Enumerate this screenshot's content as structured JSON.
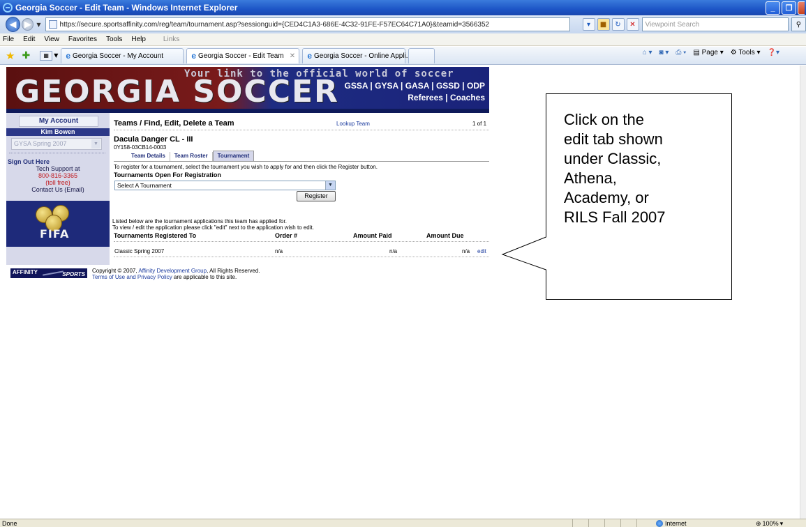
{
  "window": {
    "title": "Georgia Soccer - Edit Team - Windows Internet Explorer",
    "minimize_glyph": "_",
    "maximize_glyph": "❐",
    "close_glyph": "X"
  },
  "address_bar": {
    "url": "https://secure.sportsaffinity.com/reg/team/tournament.asp?sessionguid={CED4C1A3-686E-4C32-91FE-F57EC64C71A0}&teamid=3566352",
    "search_placeholder": "Viewpoint Search"
  },
  "menu": {
    "items": [
      "File",
      "Edit",
      "View",
      "Favorites",
      "Tools",
      "Help"
    ],
    "links_label": "Links"
  },
  "browser_tabs": [
    {
      "label": "Georgia Soccer - My Account",
      "active": false
    },
    {
      "label": "Georgia Soccer - Edit Team",
      "active": true
    },
    {
      "label": "Georgia Soccer - Online Appli...",
      "active": false
    }
  ],
  "command_bar": {
    "page_label": "Page",
    "tools_label": "Tools"
  },
  "banner": {
    "logo": "GEORGIA SOCCER",
    "tagline": "Your link to the official world of soccer",
    "orgs": "GSSA | GYSA | GASA | GSSD | ODP",
    "refs": "Referees | Coaches"
  },
  "sidebar": {
    "my_account": "My Account",
    "user_name": "Kim Bowen",
    "season_select": "GYSA Spring 2007",
    "sign_out": "Sign Out Here",
    "support_title": "Tech Support at",
    "support_phone": "800-816-3365",
    "support_tollfree": "(toll free)",
    "contact": "Contact Us (Email)",
    "fifa": "FIFA"
  },
  "main": {
    "heading": "Teams / Find, Edit, Delete a Team",
    "lookup_link": "Lookup Team",
    "count": "1 of 1",
    "team_name": "Dacula Danger CL - III",
    "team_id": "0Y158-03CB14-0003",
    "tabs": [
      "Team Details",
      "Team Roster",
      "Tournament"
    ],
    "instructions": "To register for a tournament, select the tournament you wish to apply for and then click the Register button.",
    "open_heading": "Tournaments Open For Registration",
    "select_value": "Select A Tournament",
    "register_button": "Register",
    "listed_line1": "Listed below are the tournament applications this team has applied for.",
    "listed_line2": "To view / edit the application please click \"edit\" next to the application wish to edit.",
    "table": {
      "headers": [
        "Tournaments Registered To",
        "Order #",
        "Amount Paid",
        "Amount Due"
      ],
      "rows": [
        {
          "tournament": "Classic Spring 2007",
          "order": "n/a",
          "paid": "n/a",
          "due": "n/a",
          "action": "edit"
        }
      ]
    }
  },
  "footer": {
    "logo_line1": "AFFINITY",
    "logo_line2": "SPORTS",
    "copyright_prefix": "Copyright © 2007, ",
    "copyright_link": "Affinity Development Group",
    "copyright_suffix": ", All Rights Reserved.",
    "terms_link": "Terms of Use and Privacy Policy",
    "terms_suffix": " are applicable to this site."
  },
  "callout": {
    "lines": [
      "Click on the",
      "edit tab shown",
      "under Classic,",
      "Athena,",
      "Academy, or",
      "RILS Fall 2007"
    ]
  },
  "status_bar": {
    "status": "Done",
    "zone": "Internet",
    "zoom": "100%"
  },
  "colors": {
    "banner_left": "#7a1b1b",
    "banner_right": "#1a237a",
    "sidebar_bg": "#d7d9ea",
    "link": "#1a3a9e"
  }
}
